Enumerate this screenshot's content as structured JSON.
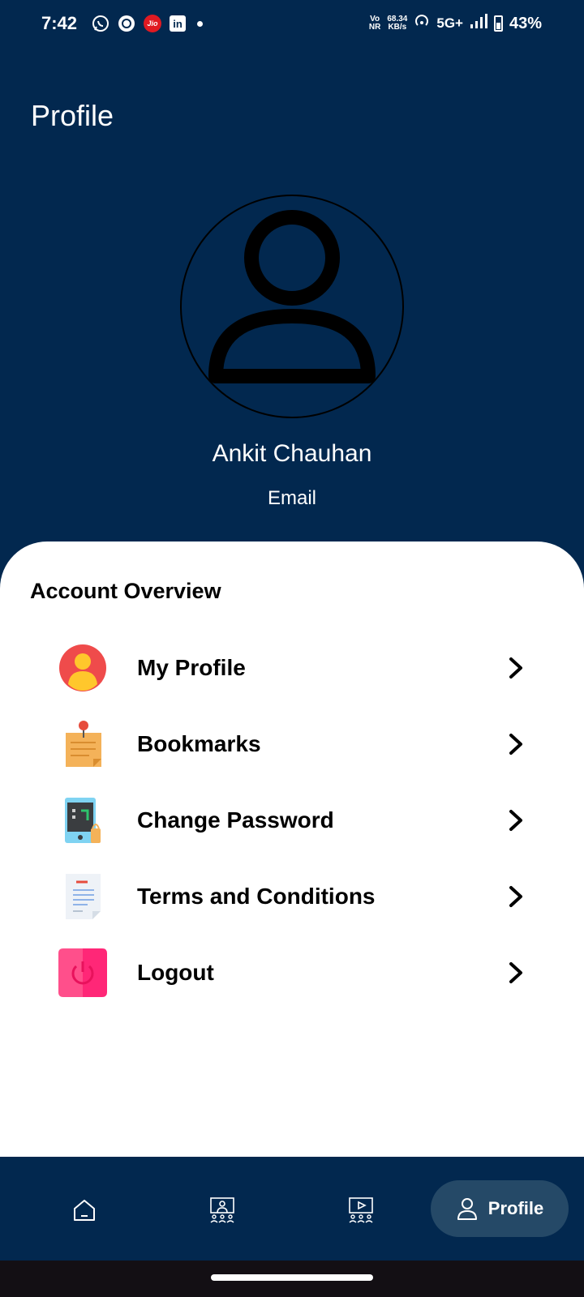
{
  "status_bar": {
    "time": "7:42",
    "net_top": "Vo",
    "net_bottom": "NR",
    "speed_value": "68.34",
    "speed_unit": "KB/s",
    "network": "5G+",
    "battery": "43%",
    "jio_label": "Jio",
    "linkedin_label": "in"
  },
  "header": {
    "title": "Profile"
  },
  "user": {
    "name": "Ankit Chauhan",
    "email": "Email"
  },
  "account": {
    "section_title": "Account Overview",
    "items": [
      {
        "label": "My Profile",
        "icon": "user-profile-icon"
      },
      {
        "label": "Bookmarks",
        "icon": "pinned-note-icon"
      },
      {
        "label": "Change Password",
        "icon": "phone-lock-icon"
      },
      {
        "label": "Terms and Conditions",
        "icon": "document-icon"
      },
      {
        "label": "Logout",
        "icon": "power-icon"
      }
    ]
  },
  "bottom_nav": {
    "items": [
      {
        "icon": "home-icon"
      },
      {
        "icon": "classroom-icon"
      },
      {
        "icon": "video-class-icon"
      }
    ],
    "active_label": "Profile"
  },
  "colors": {
    "header_bg": "#02284f",
    "active_tab_bg": "#254967",
    "panel_bg": "#ffffff"
  }
}
